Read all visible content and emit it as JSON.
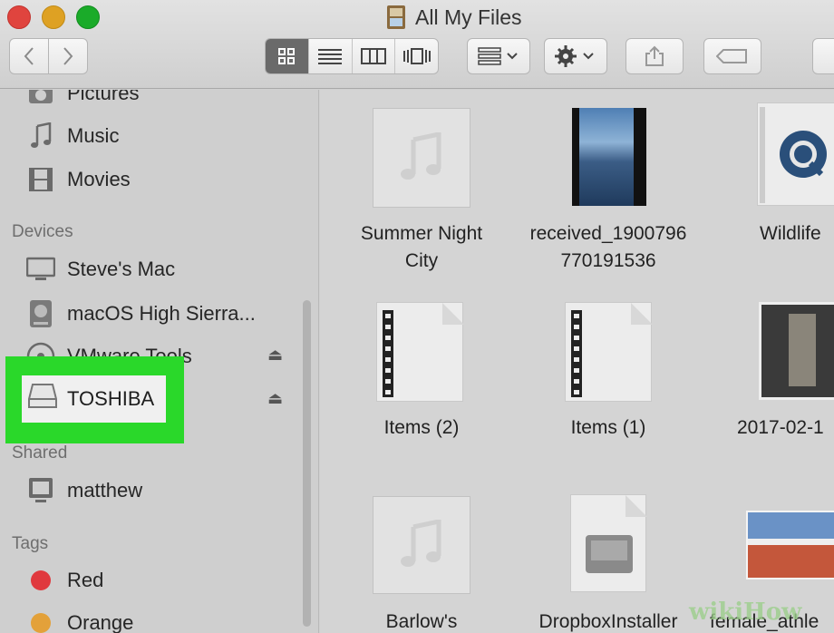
{
  "window": {
    "title": "All My Files"
  },
  "toolbar": {
    "colors": {
      "selected_view_bg": "#6a6a6a"
    }
  },
  "sidebar": {
    "top_items": [
      {
        "label": "Pictures",
        "icon": "camera-icon"
      },
      {
        "label": "Music",
        "icon": "music-note-icon"
      },
      {
        "label": "Movies",
        "icon": "film-icon"
      }
    ],
    "devices_header": "Devices",
    "devices": [
      {
        "label": "Steve's Mac",
        "icon": "monitor-icon"
      },
      {
        "label": "macOS High Sierra...",
        "icon": "hard-drive-icon"
      },
      {
        "label": "VMware Tools",
        "icon": "disc-icon"
      },
      {
        "label": "TOSHIBA",
        "icon": "external-drive-icon"
      }
    ],
    "shared_header": "Shared",
    "shared": [
      {
        "label": "matthew",
        "icon": "display-icon"
      }
    ],
    "tags_header": "Tags",
    "tags": [
      {
        "label": "Red",
        "color": "#e0393e"
      },
      {
        "label": "Orange",
        "color": "#e3a13a"
      }
    ],
    "highlight_color": "#2ad82a"
  },
  "files": [
    {
      "line1": "Summer Night",
      "line2": "City",
      "kind": "music"
    },
    {
      "line1": "received_1900796",
      "line2": "770191536",
      "kind": "video"
    },
    {
      "line1": "Wildlife",
      "line2": "",
      "kind": "quicktime"
    },
    {
      "line1": "Items (2)",
      "line2": "",
      "kind": "filmdoc"
    },
    {
      "line1": "Items (1)",
      "line2": "",
      "kind": "filmdoc"
    },
    {
      "line1": "2017-02-1",
      "line2": "",
      "kind": "photo"
    },
    {
      "line1": "Barlow's",
      "line2": "",
      "kind": "music"
    },
    {
      "line1": "DropboxInstaller",
      "line2": "",
      "kind": "diskimage"
    },
    {
      "line1": "female_athle",
      "line2": "",
      "kind": "photo"
    }
  ],
  "watermark": "wikiHow"
}
